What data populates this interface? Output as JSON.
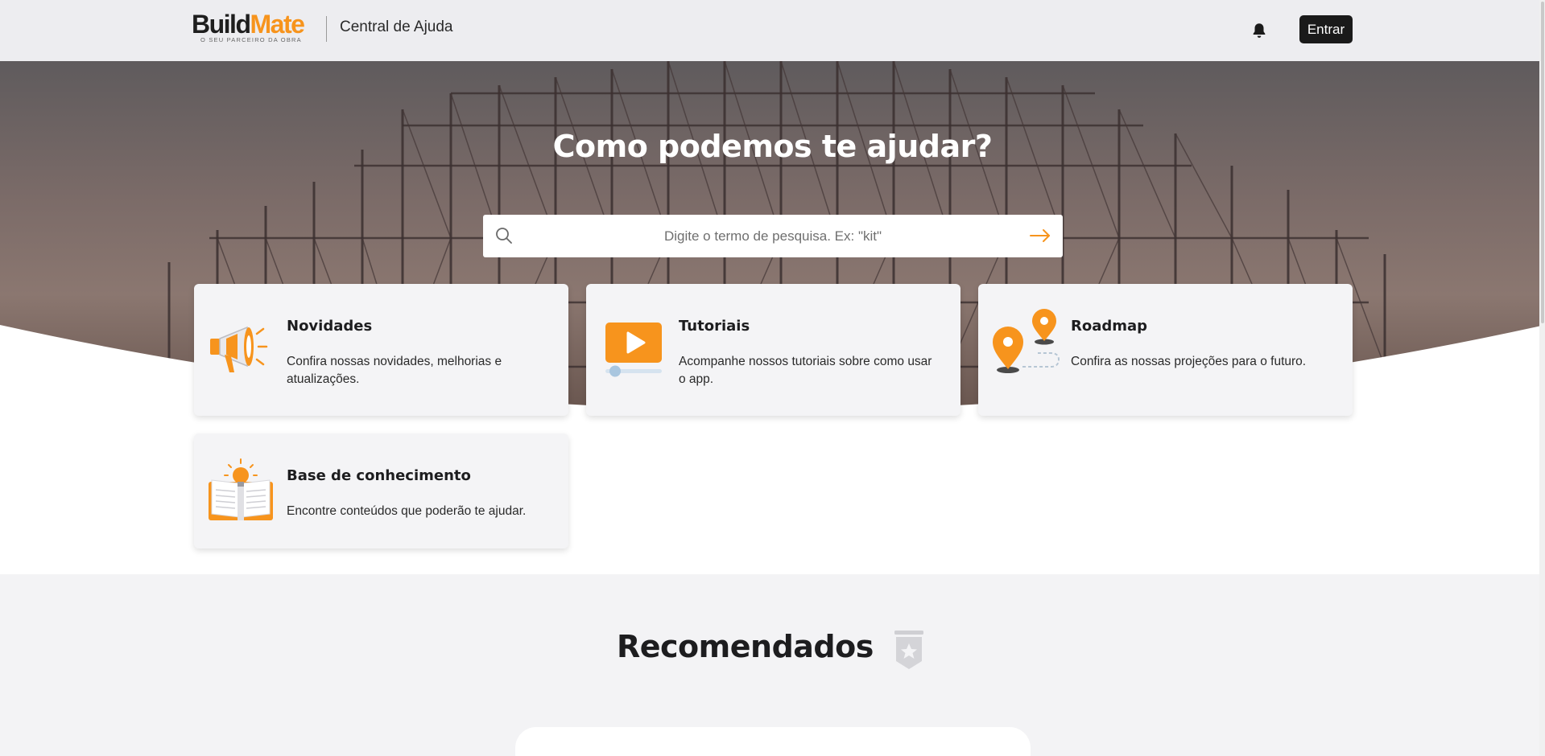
{
  "header": {
    "logo": {
      "text_part1": "Build",
      "text_part2": "Mate",
      "tagline": "O SEU PARCEIRO DA OBRA"
    },
    "title": "Central de Ajuda",
    "notification_icon": "bell-icon",
    "login_label": "Entrar"
  },
  "hero": {
    "heading": "Como podemos te ajudar?",
    "search": {
      "placeholder": "Digite o termo de pesquisa. Ex: \"kit\"",
      "value": "",
      "icon": "search-icon",
      "submit_icon": "arrow-right-icon"
    }
  },
  "cards": [
    {
      "title": "Novidades",
      "description": "Confira nossas novidades, melhorias e atualizações.",
      "icon": "megaphone-icon"
    },
    {
      "title": "Tutoriais",
      "description": "Acompanhe nossos tutoriais sobre como usar o app.",
      "icon": "video-player-icon"
    },
    {
      "title": "Roadmap",
      "description": "Confira as nossas projeções para o futuro.",
      "icon": "map-pins-icon"
    },
    {
      "title": "Base de conhecimento",
      "description": "Encontre conteúdos que poderão te ajudar.",
      "icon": "book-lightbulb-icon"
    }
  ],
  "recommended": {
    "heading": "Recomendados",
    "icon": "star-badge-icon"
  },
  "colors": {
    "accent": "#f7941d",
    "dark": "#1a1a1a",
    "header_bg": "#ededf0",
    "card_bg": "#f4f4f6"
  }
}
